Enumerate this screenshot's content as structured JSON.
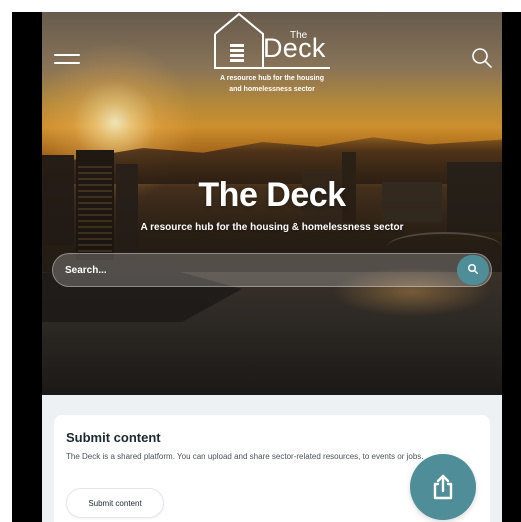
{
  "header": {
    "logo_the": "The",
    "logo_deck": "Deck",
    "tagline_line1": "A resource hub for the housing",
    "tagline_line2": "and homelessness sector",
    "menu_icon": "hamburger-menu-icon",
    "search_icon": "search-icon"
  },
  "hero": {
    "title": "The Deck",
    "subtitle": "A resource hub for the housing & homelessness sector",
    "search": {
      "placeholder": "Search...",
      "button_icon": "search-icon",
      "button_color": "#4f8e98"
    }
  },
  "submit_card": {
    "title": "Submit content",
    "text": "The Deck is a shared platform. You can upload and share sector-related resources, to events or jobs.",
    "button_label": "Submit content"
  },
  "fab": {
    "icon": "share-upload-icon",
    "color": "#4f8e98"
  }
}
